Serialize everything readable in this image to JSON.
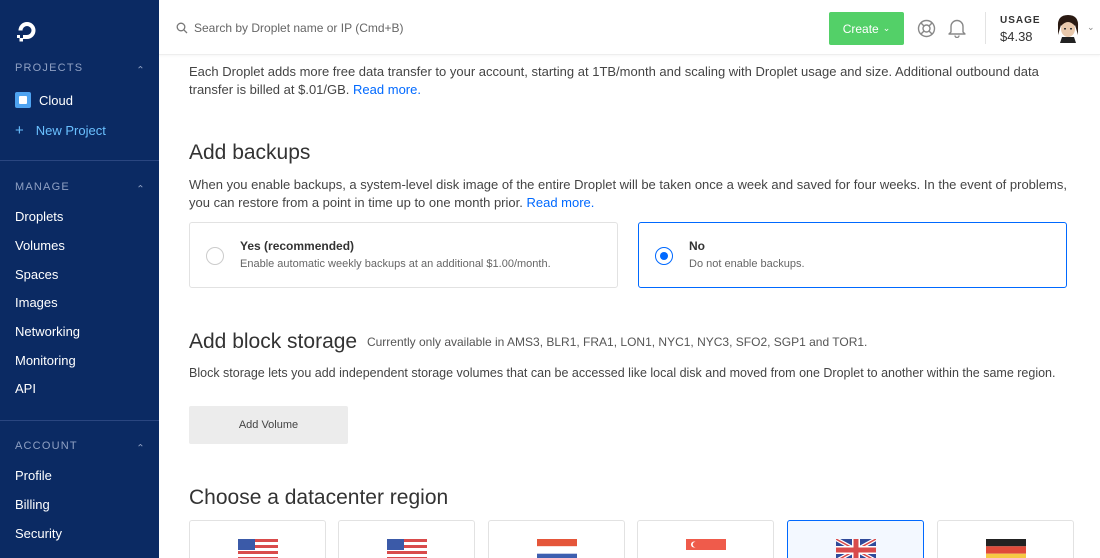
{
  "sidebar": {
    "projects_header": "PROJECTS",
    "projects": [
      {
        "label": "Cloud"
      },
      {
        "label": "New Project"
      }
    ],
    "manage_header": "MANAGE",
    "manage_items": [
      "Droplets",
      "Volumes",
      "Spaces",
      "Images",
      "Networking",
      "Monitoring",
      "API"
    ],
    "account_header": "ACCOUNT",
    "account_items": [
      "Profile",
      "Billing",
      "Security"
    ]
  },
  "topbar": {
    "search_placeholder": "Search by Droplet name or IP (Cmd+B)",
    "create_label": "Create",
    "usage_label": "USAGE",
    "usage_value": "$4.38"
  },
  "transfer": {
    "text": "Each Droplet adds more free data transfer to your account, starting at 1TB/month and scaling with Droplet usage and size. Additional outbound data transfer is billed at $.01/GB.",
    "link": "Read more."
  },
  "backups": {
    "title": "Add backups",
    "text": "When you enable backups, a system-level disk image of the entire Droplet will be taken once a week and saved for four weeks. In the event of problems, you can restore from a point in time up to one month prior.",
    "link": "Read more.",
    "options": [
      {
        "title": "Yes (recommended)",
        "desc": "Enable automatic weekly backups at an additional $1.00/month.",
        "selected": false
      },
      {
        "title": "No",
        "desc": "Do not enable backups.",
        "selected": true
      }
    ]
  },
  "block_storage": {
    "title": "Add block storage",
    "availability": "Currently only available in AMS3, BLR1, FRA1, LON1, NYC1, NYC3, SFO2, SGP1 and TOR1.",
    "text": "Block storage lets you add independent storage volumes that can be accessed like local disk and moved from one Droplet to another within the same region.",
    "button": "Add Volume"
  },
  "datacenter": {
    "title": "Choose a datacenter region",
    "regions": [
      {
        "flag": "us-flag",
        "selected": false
      },
      {
        "flag": "us-flag",
        "selected": false
      },
      {
        "flag": "nl-flag",
        "selected": false
      },
      {
        "flag": "sg-flag",
        "selected": false
      },
      {
        "flag": "uk-flag",
        "selected": true
      },
      {
        "flag": "de-flag",
        "selected": false
      }
    ]
  },
  "colors": {
    "sidebar_bg": "#0b2a63",
    "accent": "#0069ff",
    "create_green": "#53d068"
  }
}
